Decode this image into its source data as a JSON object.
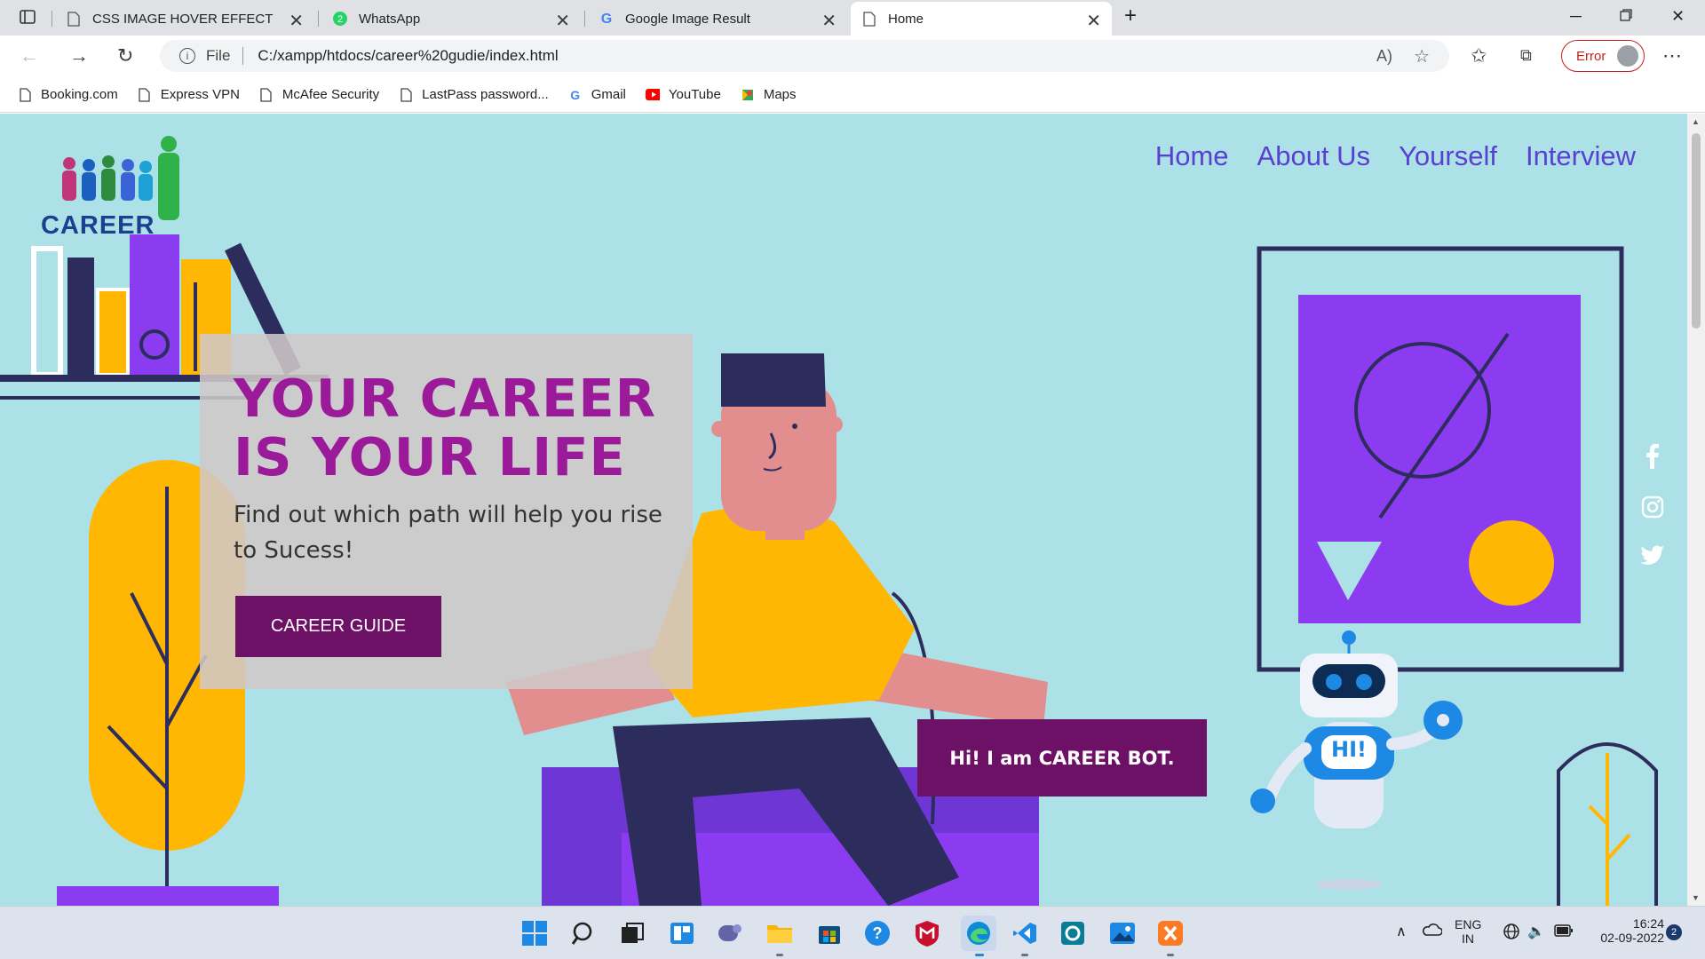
{
  "browser": {
    "tabs": [
      {
        "title": "CSS IMAGE HOVER EFFECT",
        "icon": "page-icon",
        "active": false
      },
      {
        "title": "WhatsApp",
        "icon": "whatsapp-icon",
        "active": false
      },
      {
        "title": "Google Image Result",
        "icon": "google-icon",
        "active": false
      },
      {
        "title": "Home",
        "icon": "page-icon",
        "active": true
      }
    ],
    "address": {
      "scheme_label": "File",
      "url": "C:/xampp/htdocs/career%20gudie/index.html"
    },
    "profile_status": "Error",
    "bookmarks": [
      {
        "label": "Booking.com",
        "icon": "page-icon"
      },
      {
        "label": "Express VPN",
        "icon": "page-icon"
      },
      {
        "label": "McAfee Security",
        "icon": "page-icon"
      },
      {
        "label": "LastPass password...",
        "icon": "page-icon"
      },
      {
        "label": "Gmail",
        "icon": "google-icon"
      },
      {
        "label": "YouTube",
        "icon": "youtube-icon"
      },
      {
        "label": "Maps",
        "icon": "maps-icon"
      }
    ]
  },
  "site": {
    "logo_text": "CAREER",
    "nav": [
      "Home",
      "About Us",
      "Yourself",
      "Interview"
    ],
    "hero": {
      "title": "YOUR CAREER IS YOUR LIFE",
      "subtitle": "Find out which path will help you rise to Sucess!",
      "cta": "CAREER GUIDE"
    },
    "bot_message": "Hi! I am CAREER BOT.",
    "bot_badge": "HI!",
    "social": [
      "facebook-icon",
      "instagram-icon",
      "twitter-icon"
    ]
  },
  "taskbar": {
    "language": "ENG",
    "region": "IN",
    "time": "16:24",
    "date": "02-09-2022",
    "notification_count": "2"
  },
  "colors": {
    "page_bg": "#ade1e8",
    "accent_purple": "#6d1166",
    "title_purple": "#9a1a9a",
    "nav_color": "#5a3fd0",
    "yellow": "#ffb703",
    "violet": "#8b3cf0"
  }
}
